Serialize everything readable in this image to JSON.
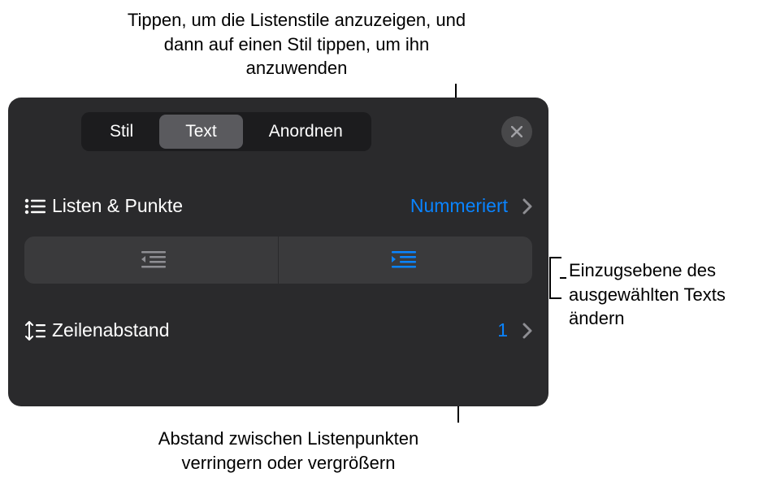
{
  "callouts": {
    "top": "Tippen, um die Listenstile anzuzeigen, und dann auf einen Stil tippen, um ihn anzuwenden",
    "right": "Einzugsebene des ausgewählten Texts ändern",
    "bottom": "Abstand zwischen Listenpunkten verringern oder vergrößern"
  },
  "tabs": {
    "stil": "Stil",
    "text": "Text",
    "anordnen": "Anordnen"
  },
  "rows": {
    "listsBullets": {
      "label": "Listen & Punkte",
      "value": "Nummeriert"
    },
    "lineSpacing": {
      "label": "Zeilenabstand",
      "value": "1"
    }
  },
  "colors": {
    "accent": "#0a84ff"
  }
}
